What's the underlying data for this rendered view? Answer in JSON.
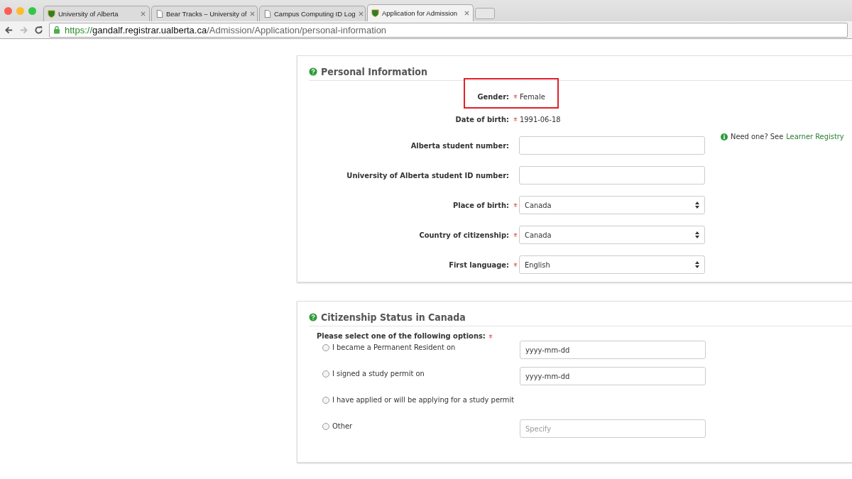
{
  "browser": {
    "tabs": [
      {
        "title": "University of Alberta",
        "kind": "site",
        "selected": false
      },
      {
        "title": "Bear Tracks – University of",
        "kind": "document",
        "selected": false
      },
      {
        "title": "Campus Computing ID Log",
        "kind": "document",
        "selected": false
      },
      {
        "title": "Application for Admission",
        "kind": "site",
        "selected": true
      }
    ],
    "url": {
      "scheme": "https://",
      "host": "gandalf.registrar.ualberta.ca",
      "path": "/Admission/Application/personal-information"
    }
  },
  "personal_information": {
    "title": "Personal Information",
    "fields": [
      {
        "label": "Gender:",
        "required": true,
        "kind": "text",
        "value": "Female",
        "highlighted": true
      },
      {
        "label": "Date of birth:",
        "required": true,
        "kind": "text",
        "value": "1991-06-18",
        "highlighted": false
      },
      {
        "label": "Alberta student number:",
        "required": false,
        "kind": "input",
        "highlighted": false,
        "help": {
          "text": "Need one? See",
          "link": "Learner Registry"
        }
      },
      {
        "label": "University of Alberta student ID number:",
        "required": false,
        "kind": "input",
        "highlighted": false
      },
      {
        "label": "Place of birth:",
        "required": true,
        "kind": "select",
        "value": "Canada",
        "highlighted": false
      },
      {
        "label": "Country of citizenship:",
        "required": true,
        "kind": "select",
        "value": "Canada",
        "highlighted": false
      },
      {
        "label": "First language:",
        "required": true,
        "kind": "select",
        "value": "English",
        "highlighted": false
      }
    ]
  },
  "citizenship_status": {
    "title": "Citizenship Status in Canada",
    "prompt": "Please select one of the following options:",
    "required": true,
    "options": [
      {
        "label": "I became a Permanent Resident on",
        "selected": false,
        "field": {
          "value": "yyyy-mm-dd"
        }
      },
      {
        "label": "I signed a study permit on",
        "selected": false,
        "field": {
          "value": "yyyy-mm-dd"
        }
      },
      {
        "label": "I have applied or will be applying for a study permit",
        "selected": false
      },
      {
        "label": "Other",
        "selected": false,
        "field": {
          "placeholder": "Specify"
        }
      }
    ]
  }
}
